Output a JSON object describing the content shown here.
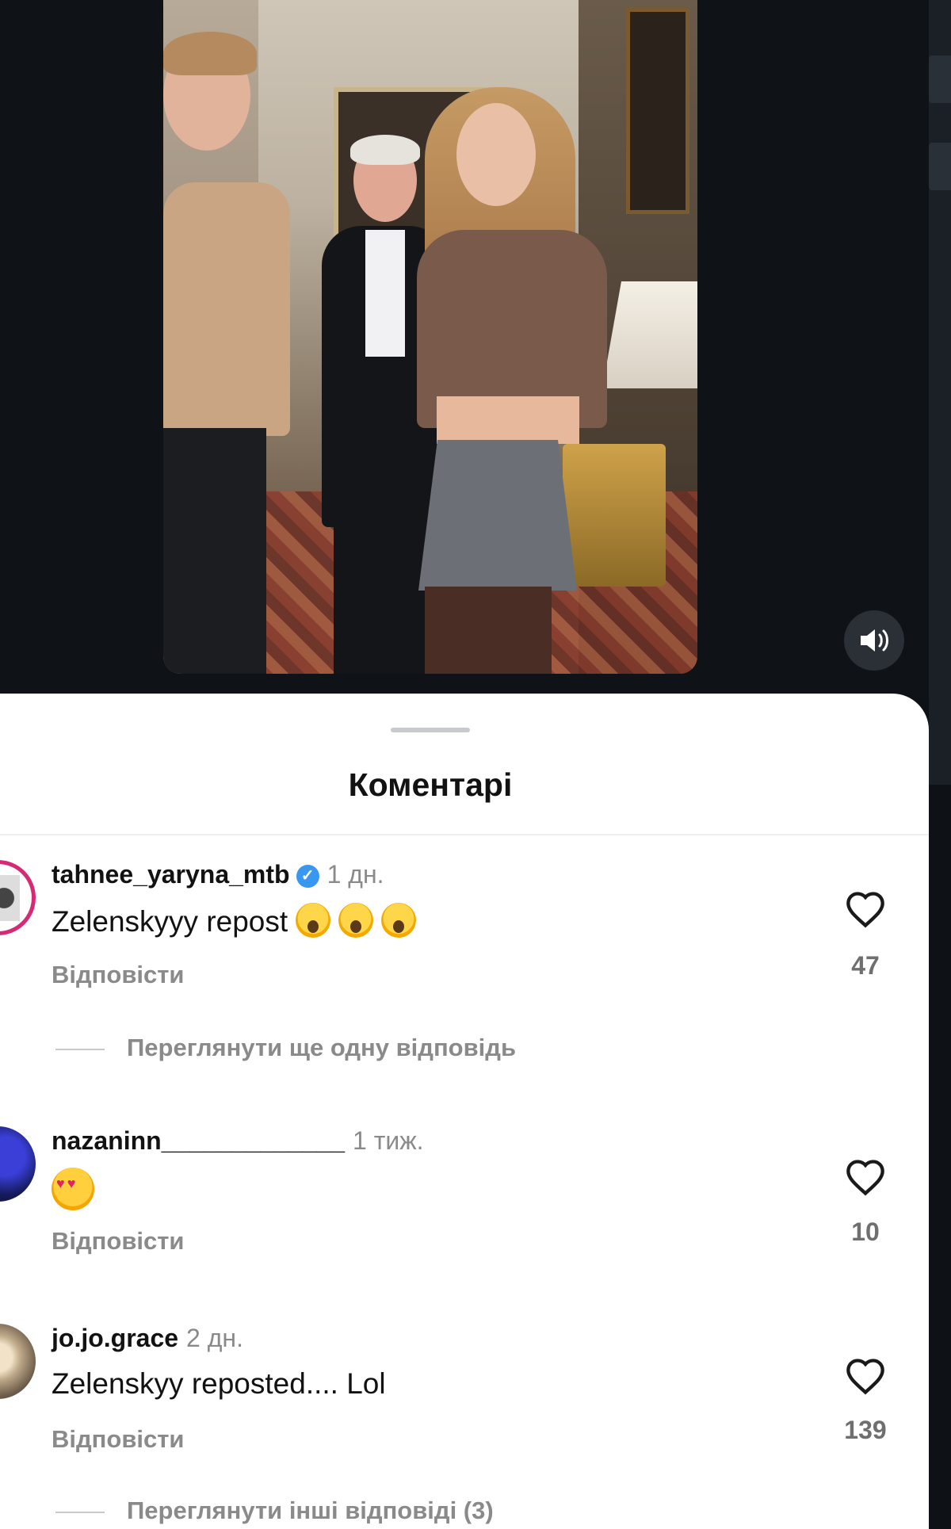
{
  "viewer": {
    "sound_icon": "speaker-icon"
  },
  "sheet": {
    "title": "Коментарі"
  },
  "comments": [
    {
      "username": "tahnee_yaryna_mtb",
      "verified": true,
      "time": "1 дн.",
      "text": "Zelenskyyy repost",
      "emoji": [
        "scream-cat",
        "scream-cat",
        "scream-cat"
      ],
      "reply": "Відповісти",
      "likes": "47",
      "view_replies": "Переглянути ще одну відповідь"
    },
    {
      "username": "nazaninn_____________",
      "verified": false,
      "time": "1 тиж.",
      "text": "",
      "emoji": [
        "heart-eyes"
      ],
      "reply": "Відповісти",
      "likes": "10"
    },
    {
      "username": "jo.jo.grace",
      "verified": false,
      "time": "2 дн.",
      "text": "Zelenskyy reposted.... Lol",
      "reply": "Відповісти",
      "likes": "139",
      "view_replies": "Переглянути інші відповіді (3)"
    }
  ],
  "colors": {
    "sheet_bg": "#ffffff",
    "viewer_bg": "#0f1318",
    "muted": "#8a8a8a",
    "verified": "#3897f0"
  }
}
